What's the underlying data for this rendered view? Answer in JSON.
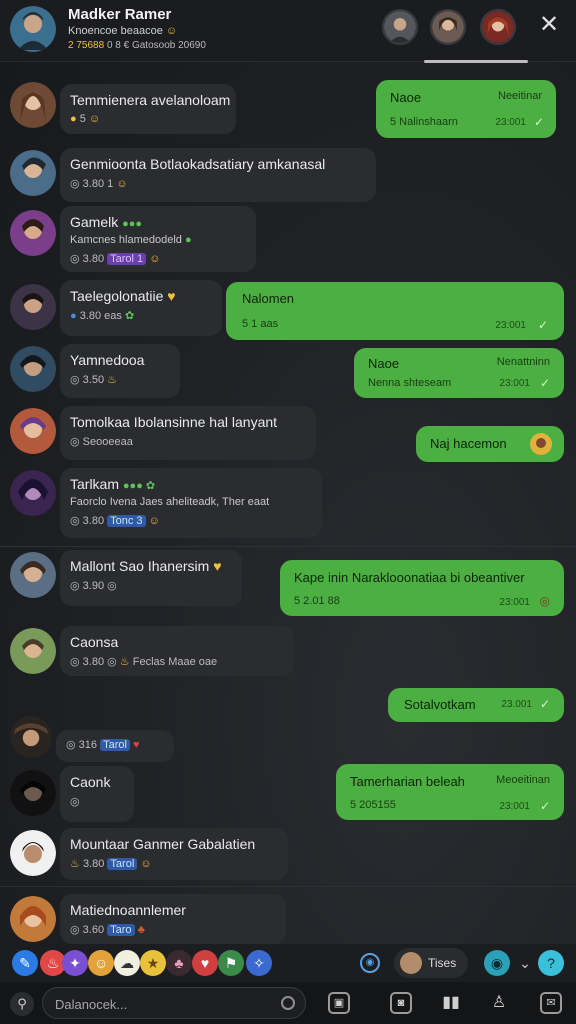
{
  "header": {
    "title": "Madker Ramer",
    "subtitle": "Knoencoe beaacoe",
    "meta_highlight": "2 75688",
    "meta_rest": "0 8 € Gatosoob 20690",
    "close_label": "✕"
  },
  "messages": [
    {
      "side": "in",
      "text": "Temmienera avelanoloam",
      "sub": "5"
    },
    {
      "side": "in",
      "text": "Genmioonta Botlaokadsatiary amkanasal",
      "sub": "3.80  1"
    },
    {
      "side": "in",
      "text": "Gamelk",
      "mid": "Kamcnes hlamedodeld",
      "sub": "3.80",
      "badge": "Tarol 1"
    },
    {
      "side": "in",
      "text": "Taelegolonatiie",
      "sub": "3.80  eas"
    },
    {
      "side": "in",
      "text": "Yamnedooa",
      "sub": "3.50"
    },
    {
      "side": "in",
      "text": "Tomolkaa Ibolansinne hal lanyant",
      "sub": "Seooeeaa"
    },
    {
      "side": "in",
      "text": "Tarlkam",
      "mid": "Faorclo Ivena Jaes  aheliteadk, Ther eaat",
      "sub": "3.80",
      "badge": "Tonc 3"
    },
    {
      "side": "in",
      "text": "Mallont Sao Ihanersim",
      "sub": "3.90"
    },
    {
      "side": "in",
      "text": "Caonsa",
      "mid": "Feclas Maae oae",
      "sub": "3.80"
    },
    {
      "side": "in",
      "text": "",
      "sub": "316",
      "badge": "Tarol"
    },
    {
      "side": "in",
      "text": "Caonk",
      "sub": ""
    },
    {
      "side": "in",
      "text": "Mountaar Ganmer Gabalatien",
      "sub": "3.80",
      "badge": "Tarol"
    },
    {
      "side": "in",
      "text": "Matiednoannlemer",
      "sub": "3.60",
      "badge": "Taro"
    }
  ],
  "outgoing": [
    {
      "title": "Naoe",
      "name": "Neeitinar",
      "line": "5  Nalinshaarn",
      "time": "23:001"
    },
    {
      "title": "Nalomen",
      "name": "",
      "line": "5  1 aas",
      "time": "23:001"
    },
    {
      "title": "Naoe",
      "name": "Nenattninn",
      "line": "Nenna shteseam",
      "time": "23:001"
    },
    {
      "title": "Naj hacemon",
      "name": "",
      "line": "",
      "time": ""
    },
    {
      "title": "Kape inin Naraklooonatiaa bi obeantiver",
      "name": "",
      "line": "5  2.01 88",
      "time": "23:001"
    },
    {
      "title": "Sotalvotkam",
      "name": "",
      "line": "",
      "time": "23.001"
    },
    {
      "title": "Tamerharian beleah",
      "name": "Meoeitinan",
      "line": "5  205155",
      "time": "23:001"
    }
  ],
  "toolbar": {
    "pill_label": "Tises"
  },
  "input": {
    "placeholder": "Dalanocek..."
  },
  "colors": {
    "outgoing_bubble": "#4caf41",
    "incoming_bubble": "#2b2c30",
    "background": "#1e2024"
  }
}
